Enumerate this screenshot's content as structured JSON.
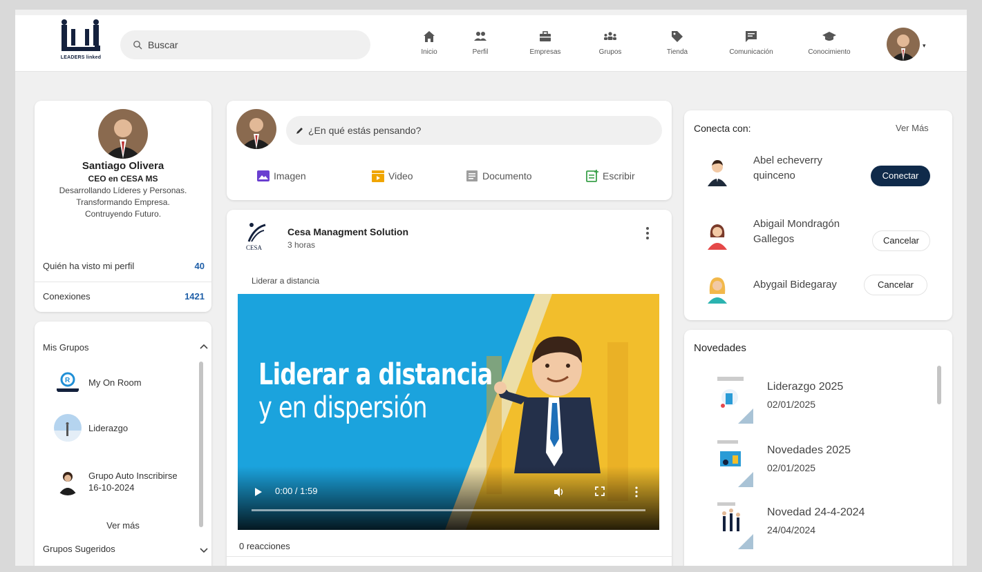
{
  "header": {
    "logo_text": "LEADERS linked",
    "search_placeholder": "Buscar",
    "nav": [
      {
        "label": "Inicio",
        "icon": "home-icon"
      },
      {
        "label": "Perfil",
        "icon": "people-icon"
      },
      {
        "label": "Empresas",
        "icon": "briefcase-icon"
      },
      {
        "label": "Grupos",
        "icon": "groups-icon"
      },
      {
        "label": "Tienda",
        "icon": "tag-icon"
      },
      {
        "label": "Comunicación",
        "icon": "chat-icon"
      },
      {
        "label": "Conocimiento",
        "icon": "graduation-cap-icon"
      }
    ]
  },
  "profile": {
    "name": "Santiago Olivera",
    "title": "CEO en CESA MS",
    "description": "Desarrollando Líderes y Personas. Transformando Empresa. Contruyendo Futuro.",
    "views_label": "Quién ha visto mi perfil",
    "views_count": "40",
    "connections_label": "Conexiones",
    "connections_count": "1421"
  },
  "groups": {
    "title": "Mis Grupos",
    "items": [
      {
        "name": "My On Room"
      },
      {
        "name": "Liderazgo"
      },
      {
        "name": "Grupo Auto Inscribirse 16-10-2024"
      }
    ],
    "see_more": "Ver más",
    "suggested_title": "Grupos Sugeridos"
  },
  "composer": {
    "placeholder": "¿En qué estás pensando?",
    "actions": [
      {
        "label": "Imagen",
        "icon": "image-icon",
        "color": "#6a3fd0"
      },
      {
        "label": "Video",
        "icon": "video-icon",
        "color": "#f0a500"
      },
      {
        "label": "Documento",
        "icon": "document-icon",
        "color": "#9e9e9e"
      },
      {
        "label": "Escribir",
        "icon": "write-icon",
        "color": "#3aa04a"
      }
    ]
  },
  "post": {
    "author": "Cesa Managment Solution",
    "logo_text": "CESA",
    "time": "3 horas",
    "caption": "Liderar a distancia",
    "video_title_line1": "Liderar a distancia",
    "video_title_line2": "y en dispersión",
    "video_time": "0:00 / 1:59",
    "reactions": "0 reacciones"
  },
  "connect": {
    "title": "Conecta con:",
    "see_more": "Ver Más",
    "people": [
      {
        "name": "Abel echeverry quinceno",
        "action": "Conectar"
      },
      {
        "name": "Abigail Mondragón Gallegos",
        "action": "Cancelar"
      },
      {
        "name": "Abygail Bidegaray",
        "action": "Cancelar"
      }
    ]
  },
  "news": {
    "title": "Novedades",
    "items": [
      {
        "name": "Liderazgo 2025",
        "date": "02/01/2025"
      },
      {
        "name": "Novedades 2025",
        "date": "02/01/2025"
      },
      {
        "name": "Novedad 24-4-2024",
        "date": "24/04/2024"
      }
    ]
  },
  "colors": {
    "accent_dark": "#0f2a4a",
    "count_blue": "#1f5fa8",
    "video_blue": "#1ba3dd",
    "video_yellow": "#f2be2c"
  }
}
